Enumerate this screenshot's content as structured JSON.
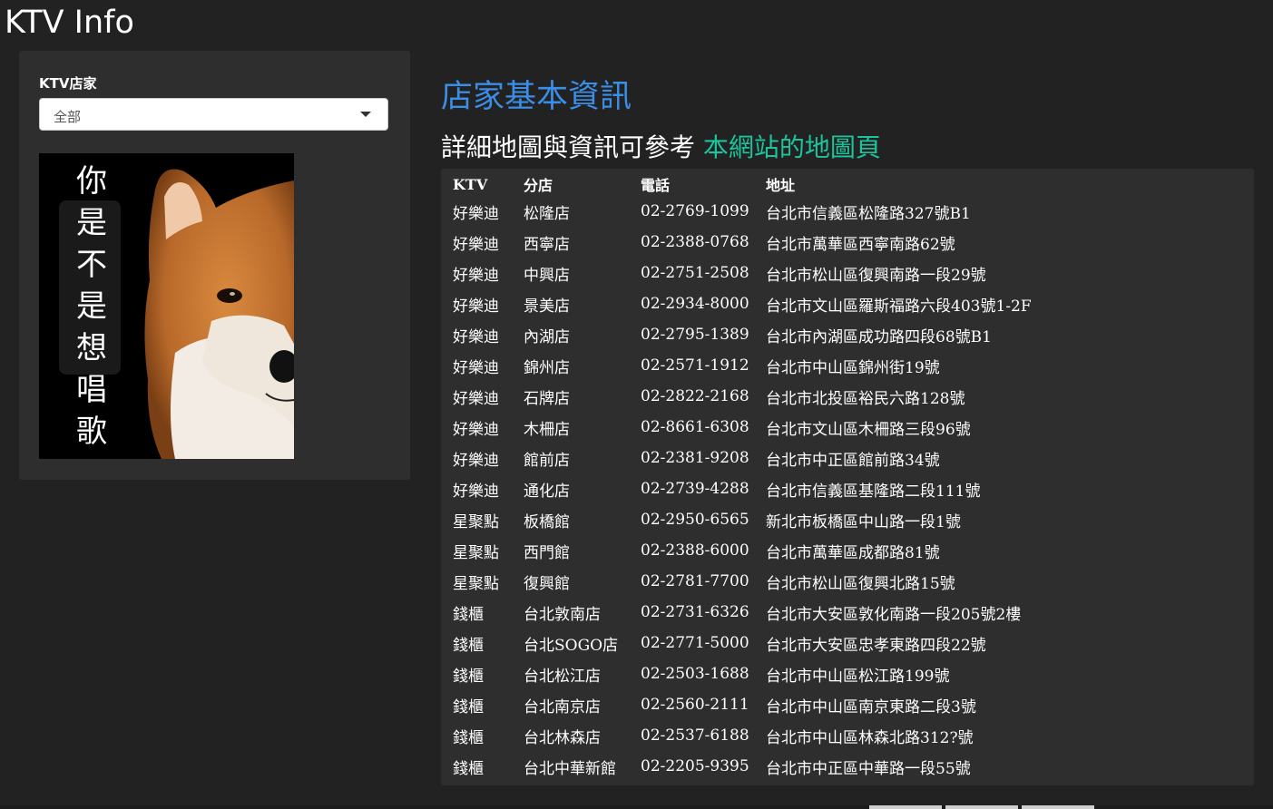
{
  "app": {
    "title": "KTV Info"
  },
  "sidebar": {
    "select_label": "KTV店家",
    "select_value": "全部",
    "promo_chars": [
      "你",
      "是",
      "不",
      "是",
      "想",
      "唱",
      "歌"
    ]
  },
  "main": {
    "heading": "店家基本資訊",
    "subheading_text": "詳細地圖與資訊可參考 ",
    "subheading_link": "本網站的地圖頁"
  },
  "table": {
    "columns": [
      "KTV",
      "分店",
      "電話",
      "地址"
    ],
    "rows": [
      [
        "好樂迪",
        "松隆店",
        "02-2769-1099",
        "台北市信義區松隆路327號B1"
      ],
      [
        "好樂迪",
        "西寧店",
        "02-2388-0768",
        "台北市萬華區西寧南路62號"
      ],
      [
        "好樂迪",
        "中興店",
        "02-2751-2508",
        "台北市松山區復興南路一段29號"
      ],
      [
        "好樂迪",
        "景美店",
        "02-2934-8000",
        "台北市文山區羅斯福路六段403號1-2F"
      ],
      [
        "好樂迪",
        "內湖店",
        "02-2795-1389",
        "台北市內湖區成功路四段68號B1"
      ],
      [
        "好樂迪",
        "錦州店",
        "02-2571-1912",
        "台北市中山區錦州街19號"
      ],
      [
        "好樂迪",
        "石牌店",
        "02-2822-2168",
        "台北市北投區裕民六路128號"
      ],
      [
        "好樂迪",
        "木柵店",
        "02-8661-6308",
        "台北市文山區木柵路三段96號"
      ],
      [
        "好樂迪",
        "館前店",
        "02-2381-9208",
        "台北市中正區館前路34號"
      ],
      [
        "好樂迪",
        "通化店",
        "02-2739-4288",
        "台北市信義區基隆路二段111號"
      ],
      [
        "星聚點",
        "板橋館",
        "02-2950-6565",
        "新北市板橋區中山路一段1號"
      ],
      [
        "星聚點",
        "西門館",
        "02-2388-6000",
        "台北市萬華區成都路81號"
      ],
      [
        "星聚點",
        "復興館",
        "02-2781-7700",
        "台北市松山區復興北路15號"
      ],
      [
        "錢櫃",
        "台北敦南店",
        "02-2731-6326",
        "台北市大安區敦化南路一段205號2樓"
      ],
      [
        "錢櫃",
        "台北SOGO店",
        "02-2771-5000",
        "台北市大安區忠孝東路四段22號"
      ],
      [
        "錢櫃",
        "台北松江店",
        "02-2503-1688",
        "台北市中山區松江路199號"
      ],
      [
        "錢櫃",
        "台北南京店",
        "02-2560-2111",
        "台北市中山區南京東路二段3號"
      ],
      [
        "錢櫃",
        "台北林森店",
        "02-2537-6188",
        "台北市中山區林森北路312?號"
      ],
      [
        "錢櫃",
        "台北中華新館",
        "02-2205-9395",
        "台北市中正區中華路一段55號"
      ]
    ]
  },
  "colors": {
    "background": "#222222",
    "panel": "#2e2e2e",
    "heading_blue": "#3a8ee6",
    "link_green": "#1cc39c"
  }
}
